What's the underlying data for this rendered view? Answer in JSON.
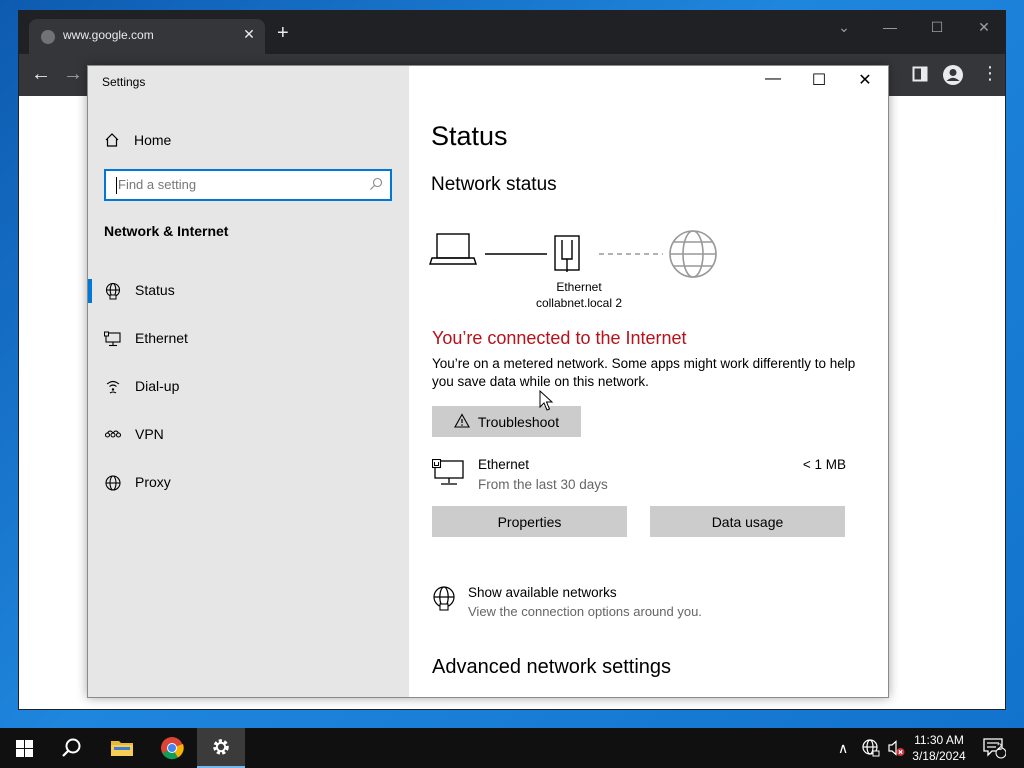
{
  "browser": {
    "tab_title": "www.google.com",
    "tab_close": "✕",
    "new_tab": "+",
    "back": "←",
    "forward": "→"
  },
  "settings": {
    "window_title": "Settings",
    "sidebar": {
      "home_label": "Home",
      "search_placeholder": "Find a setting",
      "section_title": "Network & Internet",
      "items": [
        {
          "label": "Status",
          "icon": "globe-network-icon",
          "active": true
        },
        {
          "label": "Ethernet",
          "icon": "ethernet-icon",
          "active": false
        },
        {
          "label": "Dial-up",
          "icon": "dialup-icon",
          "active": false
        },
        {
          "label": "VPN",
          "icon": "vpn-icon",
          "active": false
        },
        {
          "label": "Proxy",
          "icon": "globe-icon",
          "active": false
        }
      ]
    },
    "content": {
      "title": "Status",
      "network_status_heading": "Network status",
      "adapter_name": "Ethernet",
      "network_name": "collabnet.local 2",
      "connected_message": "You’re connected to the Internet",
      "metered_description": "You’re on a metered network. Some apps might work differently to help you save data while on this network.",
      "troubleshoot_label": "Troubleshoot",
      "usage": {
        "name": "Ethernet",
        "period": "From the last 30 days",
        "amount": "< 1 MB"
      },
      "properties_label": "Properties",
      "data_usage_label": "Data usage",
      "show_networks_title": "Show available networks",
      "show_networks_desc": "View the connection options around you.",
      "advanced_heading": "Advanced network settings"
    },
    "colors": {
      "accent": "#0078d7",
      "connected_text": "#b5121b",
      "sidebar_bg": "#e6e6e6",
      "button_bg": "#cccccc"
    }
  },
  "taskbar": {
    "time": "11:30 AM",
    "date": "3/18/2024",
    "notification_count": "2"
  }
}
